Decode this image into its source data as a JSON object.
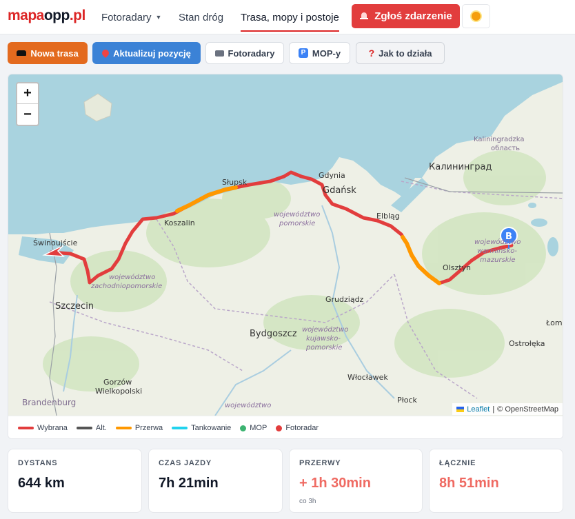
{
  "header": {
    "logo": {
      "part1": "mapa",
      "part2": "opp",
      "part3": ".pl"
    },
    "nav": [
      {
        "label": "Fotoradary"
      },
      {
        "label": "Stan dróg"
      },
      {
        "label": "Trasa, mopy i postoje"
      }
    ],
    "report_button": "Zgłoś zdarzenie",
    "accent_color": "#dc2626"
  },
  "toolbar": {
    "new_route": "Nowa trasa",
    "update_position": "Aktualizuj pozycję",
    "speed_cameras": "Fotoradary",
    "mop": "MOP-y",
    "help": "Jak to działa"
  },
  "map": {
    "zoom_in": "+",
    "zoom_out": "−",
    "marker_end_label": "B",
    "attribution": {
      "leaflet": "Leaflet",
      "separator": "|",
      "osm": "© OpenStreetMap"
    },
    "places": [
      {
        "name": "Kaliningradzka"
      },
      {
        "name": "область"
      },
      {
        "name": "Калининград"
      },
      {
        "name": "Gdynia"
      },
      {
        "name": "Gdańsk"
      },
      {
        "name": "Słupsk"
      },
      {
        "name": "Koszalin"
      },
      {
        "name": "Elbląg"
      },
      {
        "name": "Olsztyn"
      },
      {
        "name": "Świnoujście"
      },
      {
        "name": "Szczecin"
      },
      {
        "name": "Grudziądz"
      },
      {
        "name": "Bydgoszcz"
      },
      {
        "name": "Włocławek"
      },
      {
        "name": "Płock"
      },
      {
        "name": "Ostrołęka"
      },
      {
        "name": "Łom"
      },
      {
        "name": "Gorzów"
      },
      {
        "name": "Wielkopolski"
      },
      {
        "name": "Brandenburg"
      }
    ],
    "regions": [
      {
        "lines": [
          "województwo",
          "pomorskie"
        ]
      },
      {
        "lines": [
          "województwo",
          "zachodniopomorskie"
        ]
      },
      {
        "lines": [
          "województwo",
          "warmińsko-",
          "mazurskie"
        ]
      },
      {
        "lines": [
          "województwo",
          "kujawsko-",
          "pomorskie"
        ]
      },
      {
        "lines": [
          "województwo"
        ]
      }
    ]
  },
  "legend": [
    {
      "label": "Wybrana",
      "color": "#e23d3d",
      "kind": "line"
    },
    {
      "label": "Alt.",
      "color": "#555555",
      "kind": "line"
    },
    {
      "label": "Przerwa",
      "color": "#ff9800",
      "kind": "line"
    },
    {
      "label": "Tankowanie",
      "color": "#22d3ee",
      "kind": "line"
    },
    {
      "label": "MOP",
      "color": "#3cb371",
      "kind": "dot"
    },
    {
      "label": "Fotoradar",
      "color": "#e23d3d",
      "kind": "dot"
    }
  ],
  "stats": [
    {
      "label": "DYSTANS",
      "value": "644 km"
    },
    {
      "label": "CZAS JAZDY",
      "value": "7h 21min"
    },
    {
      "label": "PRZERWY",
      "value": "+ 1h 30min",
      "sub": "co 3h"
    },
    {
      "label": "ŁĄCZNIE",
      "value": "8h 51min"
    }
  ]
}
